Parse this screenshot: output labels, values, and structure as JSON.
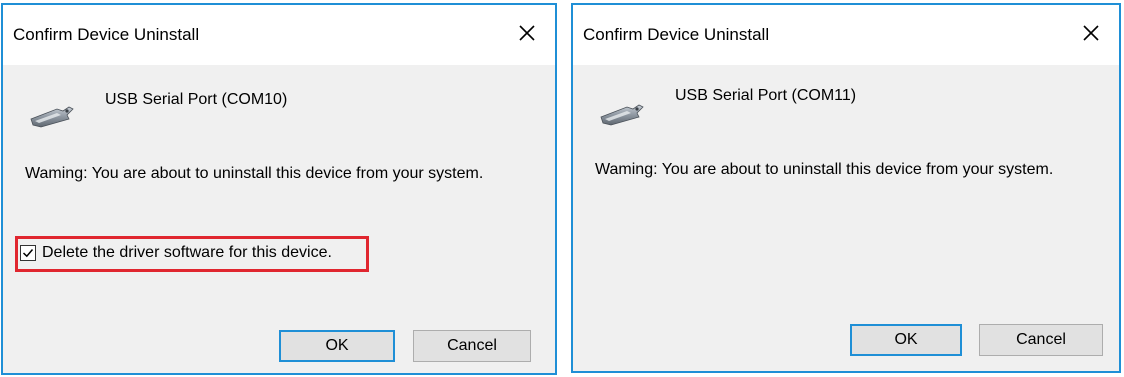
{
  "dialogs": [
    {
      "title": "Confirm Device Uninstall",
      "close_label": "Close",
      "device_icon": "serial-port-connector-icon",
      "device_name": "USB Serial Port (COM10)",
      "warning": "Waming: You are about to uninstall this device from your system.",
      "checkbox": {
        "label": "Delete the driver software for this device.",
        "checked": true,
        "highlight_color": "#e0262f"
      },
      "ok_label": "OK",
      "cancel_label": "Cancel"
    },
    {
      "title": "Confirm Device Uninstall",
      "close_label": "Close",
      "device_icon": "serial-port-connector-icon",
      "device_name": "USB Serial Port (COM11)",
      "warning": "Waming: You are about to uninstall this device from your system.",
      "ok_label": "OK",
      "cancel_label": "Cancel"
    }
  ],
  "colors": {
    "window_border": "#1f8fd6",
    "dialog_body": "#f0f0f0",
    "titlebar": "#ffffff",
    "button_face": "#e1e1e1",
    "default_button_border": "#1f8fd6"
  }
}
